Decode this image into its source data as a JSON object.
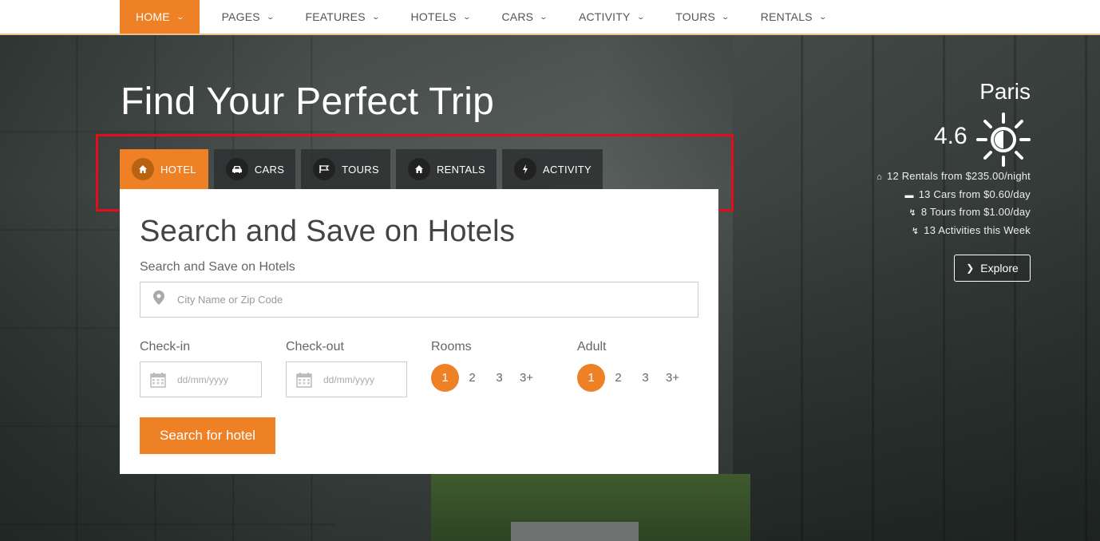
{
  "nav": {
    "items": [
      {
        "label": "HOME",
        "active": true
      },
      {
        "label": "PAGES",
        "active": false
      },
      {
        "label": "FEATURES",
        "active": false
      },
      {
        "label": "HOTELS",
        "active": false
      },
      {
        "label": "CARS",
        "active": false
      },
      {
        "label": "ACTIVITY",
        "active": false
      },
      {
        "label": "TOURS",
        "active": false
      },
      {
        "label": "RENTALS",
        "active": false
      }
    ]
  },
  "hero": {
    "title": "Find Your Perfect Trip"
  },
  "tabs": [
    {
      "label": "HOTEL",
      "icon": "home-icon",
      "active": true
    },
    {
      "label": "CARS",
      "icon": "car-icon",
      "active": false
    },
    {
      "label": "TOURS",
      "icon": "flag-icon",
      "active": false
    },
    {
      "label": "RENTALS",
      "icon": "home-icon",
      "active": false
    },
    {
      "label": "ACTIVITY",
      "icon": "bolt-icon",
      "active": false
    }
  ],
  "search": {
    "heading": "Search and Save on Hotels",
    "location_label": "Search and Save on Hotels",
    "location_placeholder": "City Name or Zip Code",
    "checkin_label": "Check-in",
    "checkin_placeholder": "dd/mm/yyyy",
    "checkout_label": "Check-out",
    "checkout_placeholder": "dd/mm/yyyy",
    "rooms_label": "Rooms",
    "rooms_options": [
      "1",
      "2",
      "3",
      "3+"
    ],
    "rooms_selected": "1",
    "adult_label": "Adult",
    "adult_options": [
      "1",
      "2",
      "3",
      "3+"
    ],
    "adult_selected": "1",
    "button_label": "Search for hotel"
  },
  "location": {
    "city": "Paris",
    "temperature": "4.6",
    "weather_icon": "sun-icon",
    "stats": [
      {
        "icon": "home-icon",
        "text": "12 Rentals from $235.00/night"
      },
      {
        "icon": "car-icon",
        "text": "13 Cars from $0.60/day"
      },
      {
        "icon": "bolt-icon",
        "text": "8 Tours from $1.00/day"
      },
      {
        "icon": "bolt-icon",
        "text": "13 Activities this Week"
      }
    ],
    "explore_label": "Explore"
  },
  "colors": {
    "accent": "#ee8126",
    "highlight_box": "#e30e1b",
    "tab_bg": "#2d3030"
  }
}
